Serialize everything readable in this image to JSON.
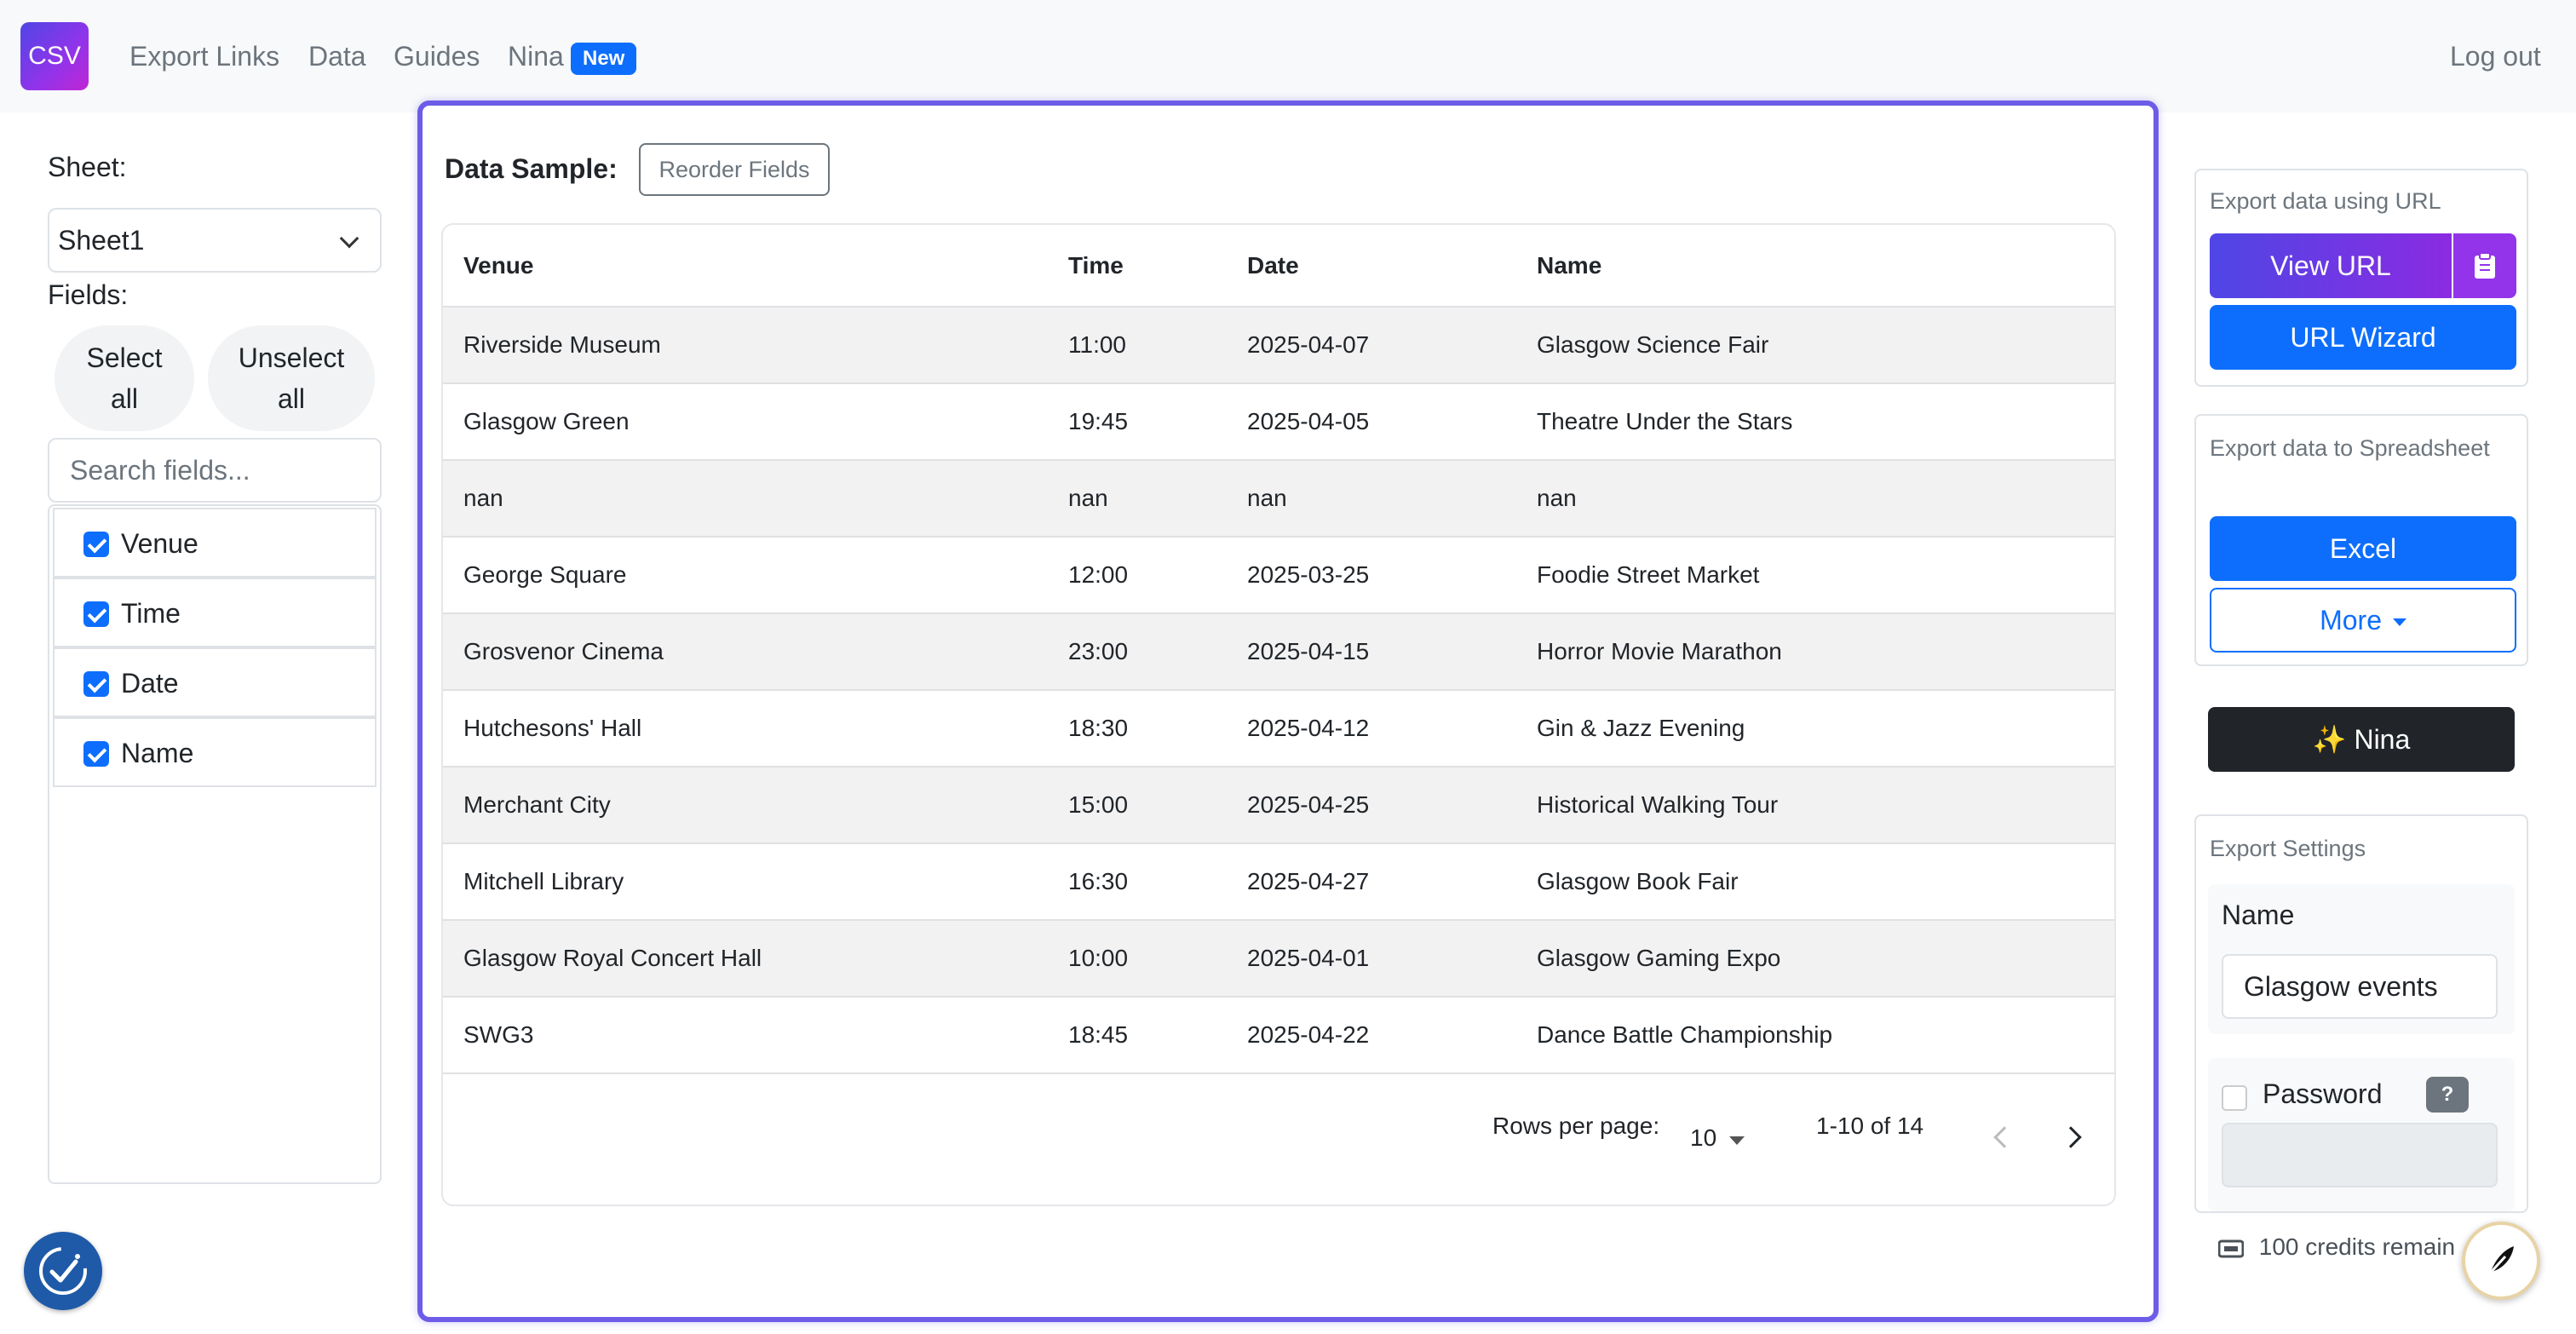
{
  "nav": {
    "logo": "CSV",
    "links": [
      "Export Links",
      "Data",
      "Guides",
      "Nina"
    ],
    "badge": "New",
    "logout": "Log out"
  },
  "left": {
    "sheet_label": "Sheet:",
    "sheet_value": "Sheet1",
    "fields_label": "Fields:",
    "select_all_1": "Select",
    "select_all_2": "all",
    "unselect_all_1": "Unselect",
    "unselect_all_2": "all",
    "search_placeholder": "Search fields...",
    "fields": [
      {
        "label": "Venue",
        "checked": true
      },
      {
        "label": "Time",
        "checked": true
      },
      {
        "label": "Date",
        "checked": true
      },
      {
        "label": "Name",
        "checked": true
      }
    ]
  },
  "main": {
    "title": "Data Sample:",
    "reorder": "Reorder Fields",
    "columns": [
      "Venue",
      "Time",
      "Date",
      "Name"
    ],
    "rows": [
      [
        "Riverside Museum",
        "11:00",
        "2025-04-07",
        "Glasgow Science Fair"
      ],
      [
        "Glasgow Green",
        "19:45",
        "2025-04-05",
        "Theatre Under the Stars"
      ],
      [
        "nan",
        "nan",
        "nan",
        "nan"
      ],
      [
        "George Square",
        "12:00",
        "2025-03-25",
        "Foodie Street Market"
      ],
      [
        "Grosvenor Cinema",
        "23:00",
        "2025-04-15",
        "Horror Movie Marathon"
      ],
      [
        "Hutchesons' Hall",
        "18:30",
        "2025-04-12",
        "Gin & Jazz Evening"
      ],
      [
        "Merchant City",
        "15:00",
        "2025-04-25",
        "Historical Walking Tour"
      ],
      [
        "Mitchell Library",
        "16:30",
        "2025-04-27",
        "Glasgow Book Fair"
      ],
      [
        "Glasgow Royal Concert Hall",
        "10:00",
        "2025-04-01",
        "Glasgow Gaming Expo"
      ],
      [
        "SWG3",
        "18:45",
        "2025-04-22",
        "Dance Battle Championship"
      ]
    ],
    "pager": {
      "rows_per_page_label": "Rows per page:",
      "rows_per_page": "10",
      "range": "1-10 of 14"
    }
  },
  "right": {
    "url_head": "Export data using URL",
    "view_url": "View URL",
    "url_wizard": "URL Wizard",
    "sheet_head": "Export data to Spreadsheet",
    "excel": "Excel",
    "more": "More",
    "nina": "✨ Nina",
    "settings_head": "Export Settings",
    "name_label": "Name",
    "name_value": "Glasgow events",
    "password_label": "Password",
    "help": "?",
    "credits": "100 credits remain"
  },
  "colors": {
    "accent": "#6c5ce7",
    "primary": "#0d6efd",
    "dark": "#212529"
  }
}
